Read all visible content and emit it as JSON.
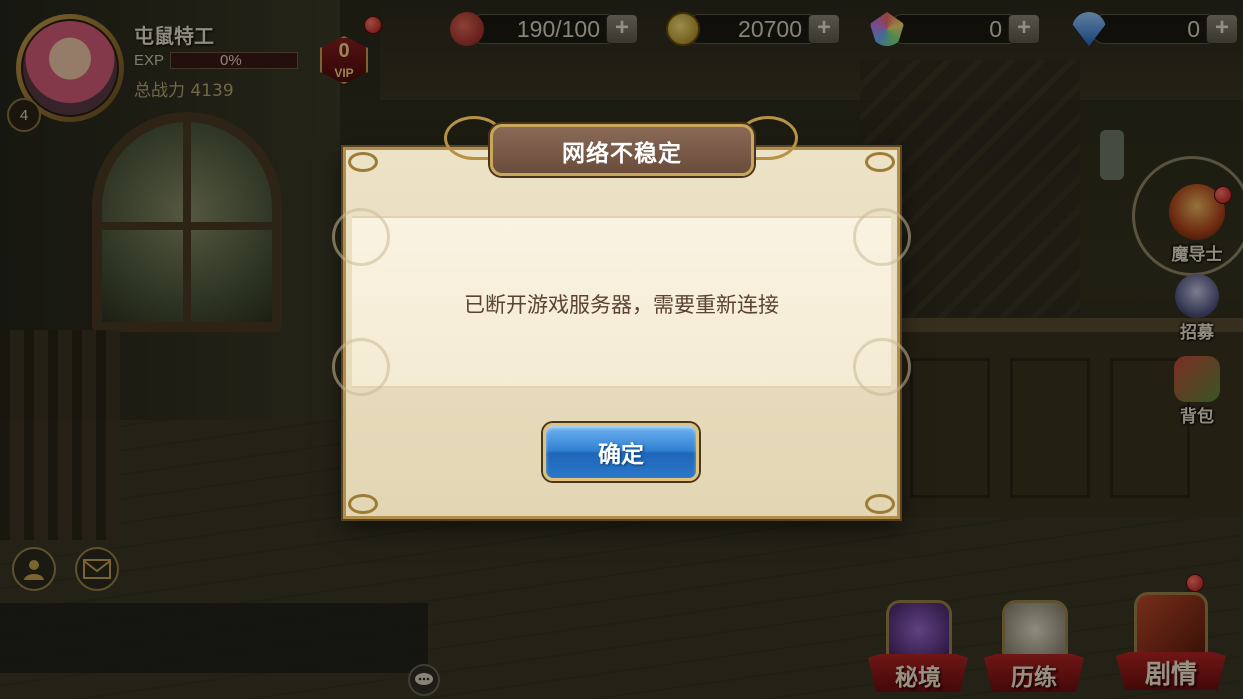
{
  "player": {
    "name": "屯鼠特工",
    "level": "4",
    "exp_label": "EXP",
    "exp_percent": "0%",
    "power": "总战力 4139",
    "vip_level": "0",
    "vip_label": "VIP"
  },
  "resources": [
    {
      "icon": "meat-stamina-icon",
      "value": "190/100"
    },
    {
      "icon": "gold-coin-icon",
      "value": "20700"
    },
    {
      "icon": "rainbow-gem-icon",
      "value": "0"
    },
    {
      "icon": "blue-diamond-icon",
      "value": "0"
    }
  ],
  "plus_label": "+",
  "side_menu": [
    {
      "label": "魔导士",
      "icon": "mage-portrait-icon"
    },
    {
      "label": "招募",
      "icon": "recruit-icon"
    },
    {
      "label": "背包",
      "icon": "backpack-icon"
    }
  ],
  "bottom_menu": [
    {
      "label": "秘境",
      "icon": "secret-realm-icon"
    },
    {
      "label": "历练",
      "icon": "training-icon"
    },
    {
      "label": "剧情",
      "icon": "story-book-icon"
    }
  ],
  "dialog": {
    "title": "网络不稳定",
    "message": "已断开游戏服务器，需要重新连接",
    "confirm_label": "确定"
  },
  "colors": {
    "confirm_button": "#2f7fd1",
    "dialog_bg": "#ece2c6",
    "title_plate": "#7a5a48",
    "ribbon": "#b52424"
  }
}
